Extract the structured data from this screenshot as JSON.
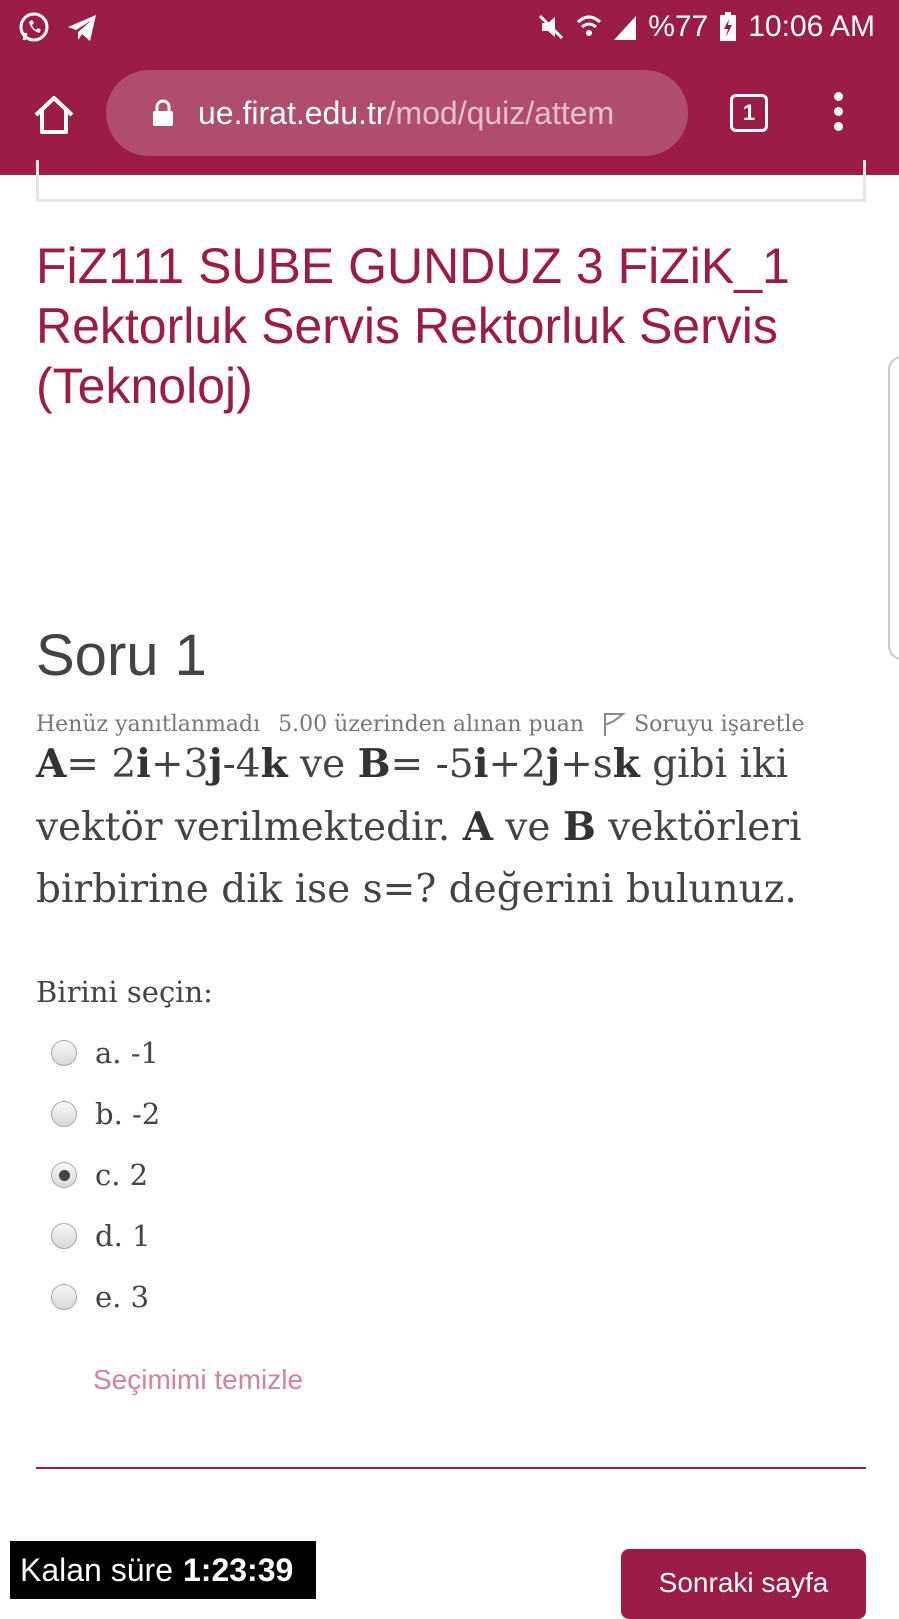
{
  "status_bar": {
    "battery": "%77",
    "time": "10:06 AM",
    "icons": [
      "whatsapp-icon",
      "telegram-icon",
      "mute-icon",
      "wifi-icon",
      "signal-icon",
      "battery-charging-icon"
    ]
  },
  "browser": {
    "url_host": "ue.firat.edu.tr",
    "url_path": "/mod/quiz/attem",
    "tab_count": "1"
  },
  "course": {
    "title": "FiZ111 SUBE GUNDUZ 3 FiZiK_1 Rektorluk Servis Rektorluk Servis (Teknoloj)"
  },
  "question": {
    "title": "Soru 1",
    "status": "Henüz yanıtlanmadı",
    "points": "5.00 üzerinden alınan puan",
    "flag_label": "Soruyu işaretle",
    "select_label": "Birini seçin:",
    "options": [
      {
        "label": "a. -1",
        "selected": false
      },
      {
        "label": "b. -2",
        "selected": false
      },
      {
        "label": "c. 2",
        "selected": true
      },
      {
        "label": "d. 1",
        "selected": false
      },
      {
        "label": "e. 3",
        "selected": false
      }
    ],
    "clear_label": "Seçimimi temizle"
  },
  "footer": {
    "timer_label": "Kalan süre",
    "timer_value": "1:23:39",
    "next_label": "Sonraki sayfa"
  },
  "colors": {
    "brand": "#9b1c46",
    "url_pill": "#b04d6f",
    "link": "#d183a0"
  }
}
